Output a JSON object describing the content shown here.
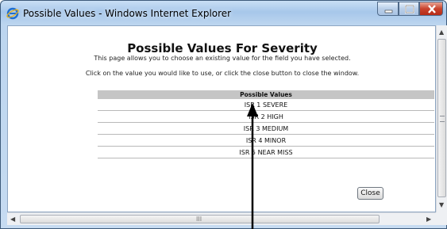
{
  "window": {
    "title": "Possible Values - Windows Internet Explorer",
    "controls": [
      "minimize-icon",
      "maximize-icon",
      "close-icon"
    ],
    "colors": {
      "close_button": "#c9432d",
      "frame": "#a7c7ea"
    }
  },
  "page": {
    "heading": "Possible Values For Severity",
    "subtitle": "This page allows you to choose an existing value for the field you have selected.",
    "instruction": "Click on the value you would like to use, or click the close button to close the window.",
    "table": {
      "header": "Possible Values",
      "rows": [
        "ISR 1 SEVERE",
        "ISR 2 HIGH",
        "ISR 3 MEDIUM",
        "ISR 4 MINOR",
        "ISR 5 NEAR MISS"
      ]
    },
    "close_label": "Close"
  },
  "scrollbar": {
    "horizontal_grip": "III"
  }
}
